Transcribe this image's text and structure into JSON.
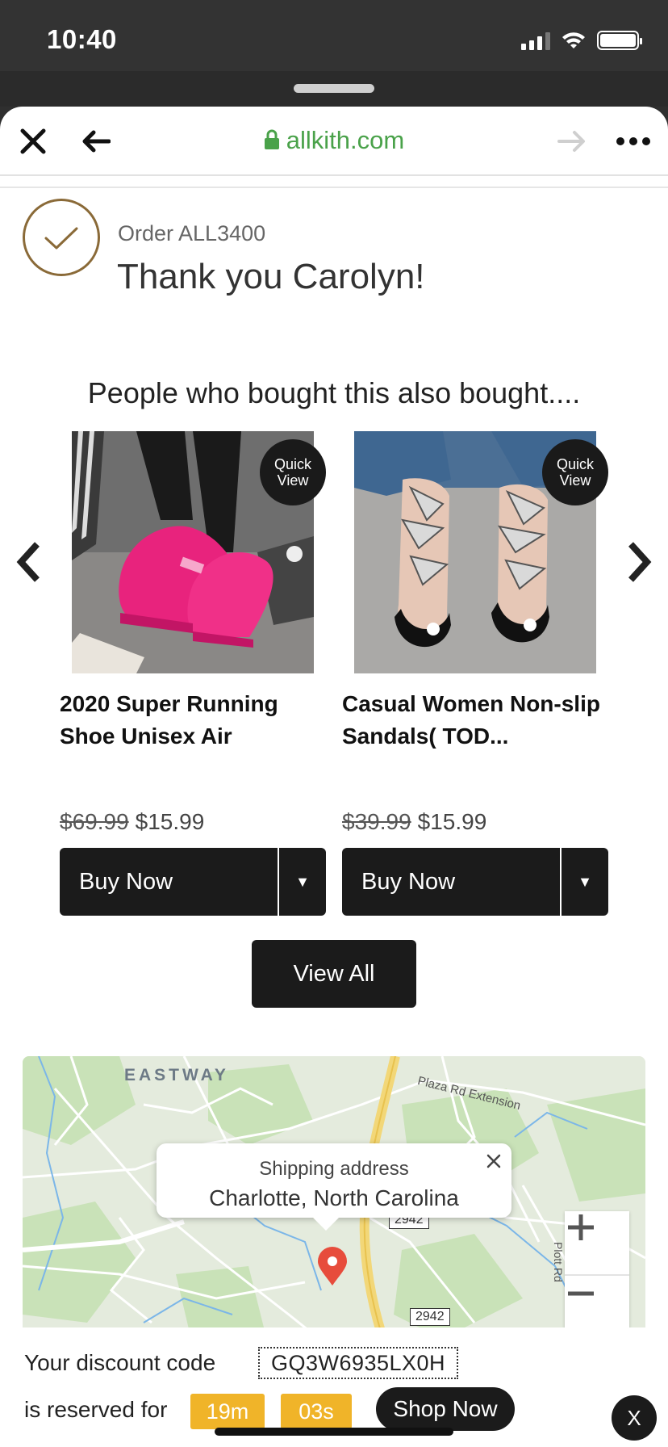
{
  "status_bar": {
    "time": "10:40"
  },
  "browser": {
    "url": "allkith.com"
  },
  "order": {
    "label": "Order ALL3400",
    "thanks": "Thank you Carolyn!"
  },
  "recommendations": {
    "title": "People who bought this also bought....",
    "quick_view_label_line1": "Quick",
    "quick_view_label_line2": "View",
    "products": [
      {
        "title": "2020 Super Running Shoe Unisex Air",
        "old_price": "$69.99",
        "price": "$15.99",
        "buy_label": "Buy Now",
        "image": "pink-sneaker-photo"
      },
      {
        "title": "Casual Women Non-slip Sandals( TOD...",
        "old_price": "$39.99",
        "price": "$15.99",
        "buy_label": "Buy Now",
        "image": "butterfly-sandal-photo"
      }
    ],
    "view_all_label": "View All"
  },
  "map": {
    "popup_label": "Shipping address",
    "popup_city": "Charlotte, North Carolina",
    "place_labels": {
      "eastway": "EASTWAY",
      "plaza": "Plaza Rd Extension",
      "plott": "Plott Rd"
    },
    "route_numbers": {
      "a": "2942",
      "b": "2942"
    }
  },
  "discount": {
    "code_label": "Your discount code",
    "code": "GQ3W6935LX0H",
    "reserve_label": "is reserved for",
    "minutes": "19m",
    "seconds": "03s",
    "shop_now_label": "Shop Now",
    "close_label": "X"
  },
  "colors": {
    "accent_green": "#4aa24a",
    "timer": "#f0b429",
    "check": "#8a6a38",
    "button_dark": "#1b1b1b"
  }
}
